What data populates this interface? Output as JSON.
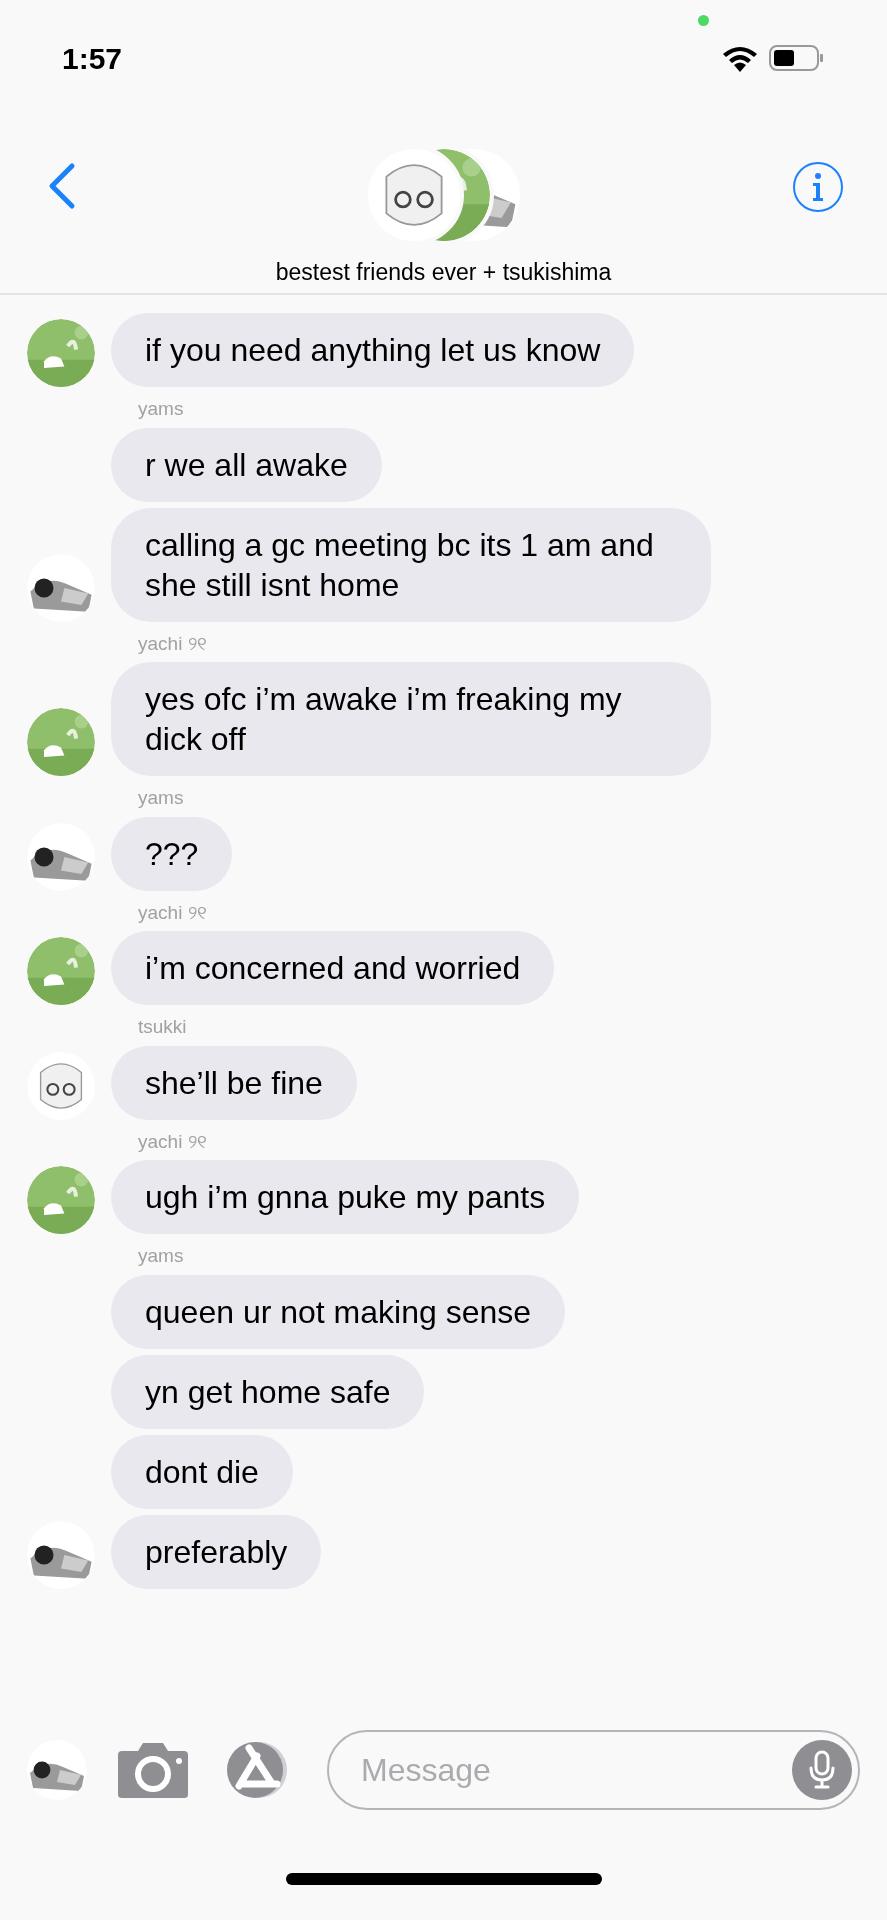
{
  "status_bar": {
    "time": "1:57"
  },
  "header": {
    "title": "bestest friends ever + tsukishima",
    "avatars": [
      {
        "kind": "picture",
        "color": "#e6e6e6"
      },
      {
        "kind": "picture",
        "color": "#8fbf6a"
      },
      {
        "kind": "picture",
        "color": "#9a9a9a"
      }
    ]
  },
  "groups": [
    {
      "avatar": {
        "kind": "picture",
        "color": "#8fbf6a"
      },
      "messages": [
        "if you need anything let us know"
      ]
    },
    {
      "sender": "yams",
      "avatar": {
        "kind": "picture",
        "color": "#9a9a9a"
      },
      "messages": [
        "r we all awake",
        "calling a gc meeting bc its 1 am and she still isnt home"
      ]
    },
    {
      "sender": "yachi ୨୧",
      "avatar": {
        "kind": "picture",
        "color": "#8fbf6a"
      },
      "messages": [
        "yes ofc i’m awake i’m freaking my dick off"
      ]
    },
    {
      "sender": "yams",
      "avatar": {
        "kind": "picture",
        "color": "#9a9a9a"
      },
      "messages": [
        "???"
      ]
    },
    {
      "sender": "yachi ୨୧",
      "avatar": {
        "kind": "picture",
        "color": "#8fbf6a"
      },
      "messages": [
        "i’m concerned and worried"
      ]
    },
    {
      "sender": "tsukki",
      "avatar": {
        "kind": "picture",
        "color": "#e6e6e6"
      },
      "messages": [
        "she’ll be fine"
      ]
    },
    {
      "sender": "yachi ୨୧",
      "avatar": {
        "kind": "picture",
        "color": "#8fbf6a"
      },
      "messages": [
        "ugh i’m gnna puke my pants"
      ]
    },
    {
      "sender": "yams",
      "avatar": {
        "kind": "picture",
        "color": "#9a9a9a"
      },
      "messages": [
        "queen ur not making sense",
        "yn get home safe",
        "dont die",
        "preferably"
      ]
    }
  ],
  "composer": {
    "avatar": {
      "kind": "picture",
      "color": "#9a9a9a"
    },
    "placeholder": "Message"
  }
}
